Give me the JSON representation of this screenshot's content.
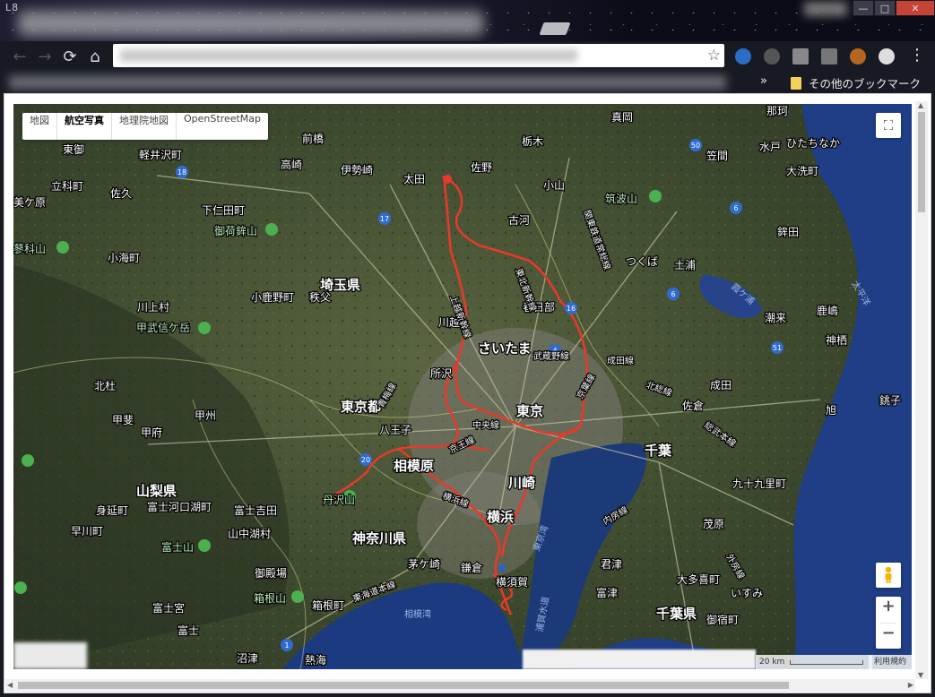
{
  "window": {
    "app_mark": "L8",
    "minimize": "—",
    "maximize": "□",
    "close": "✕"
  },
  "toolbar": {
    "back": "←",
    "forward": "→",
    "reload": "⟳",
    "home": "⌂",
    "star": "☆",
    "menu": "⋮"
  },
  "bookmarks": {
    "more": "»",
    "other": "その他のブックマーク"
  },
  "map": {
    "types": [
      "地図",
      "航空写真",
      "地理院地図",
      "OpenStreetMap"
    ],
    "active_type": "航空写真",
    "fullscreen": "⛶",
    "zoom_in": "+",
    "zoom_out": "−",
    "scale": "20 km",
    "terms": "利用規約",
    "route_color": "#e53a2c",
    "prefectures": {
      "saitama": "埼玉県",
      "tokyo": "東京都",
      "kanagawa": "神奈川県",
      "yamanashi": "山梨県",
      "chiba": "千葉県"
    },
    "cities": {
      "maebashi": "前橋",
      "takasaki": "高崎",
      "isesaki": "伊勢崎",
      "ota": "太田",
      "sano": "佐野",
      "tochigi": "栃木",
      "mooka": "真岡",
      "kasama": "笠間",
      "mito": "水戸",
      "hitachinaka": "ひたちなか",
      "oarai": "大洗町",
      "nakagawa": "那珂",
      "oyama": "小山",
      "koga": "古河",
      "tsukuba": "つくば",
      "tsuchiura": "土浦",
      "hokota": "鉾田",
      "kashima": "鹿嶋",
      "kamisu": "神栖",
      "itako": "潮来",
      "choshi": "銚子",
      "asahi": "旭",
      "narita": "成田",
      "sakura": "佐倉",
      "chiba": "千葉",
      "kujukuri": "九十九里町",
      "mobara": "茂原",
      "otaki": "大多喜町",
      "isumi": "いすみ",
      "onjuku": "御宿町",
      "kisarazu": "君津",
      "futtsu": "富津",
      "kasukabe": "春日部",
      "saitama": "さいたま",
      "kawagoe": "川越",
      "tokorozawa": "所沢",
      "chichibu": "秩父",
      "ogano": "小鹿野町",
      "tokyo": "東京",
      "hachioji": "八王子",
      "sagamihara": "相模原",
      "kawasaki": "川崎",
      "yokohama": "横浜",
      "chigasaki": "茅ケ崎",
      "kamakura": "鎌倉",
      "yokosuka": "横須賀",
      "hakone": "箱根町",
      "atami": "熱海",
      "numazu": "沼津",
      "odawara": "御殿場",
      "yamanakako": "山中湖村",
      "fujiyoshida": "富士吉田",
      "fujikawaguchiko": "富士河口湖町",
      "mishima": "富士宮",
      "fuji": "富士",
      "minobu": "身延町",
      "hayakawa": "早川町",
      "kofu": "甲府",
      "kai": "甲斐",
      "koshu": "甲州",
      "hokuto": "北杜",
      "komagane": "小海町",
      "kawakami": "川上村",
      "saku": "佐久",
      "karuizawa": "軽井沢町",
      "tomi": "東御",
      "tateshina": "立科町",
      "miyota": "美ケ原",
      "shimonita": "下仁田町"
    },
    "mountains": {
      "tsukuba": "筑波山",
      "ontakesan": "御荷鉾山",
      "kobushi": "甲武信ケ岳",
      "tanzawa": "丹沢山",
      "fuji": "富士山",
      "hakone": "箱根山",
      "tateshina": "蓼科山"
    },
    "rail_lines": {
      "joetsu": "上越新幹線",
      "tohoku": "東北新幹線",
      "kanto": "関東鉄道常総線",
      "musashino": "武蔵野線",
      "chuo": "中央線",
      "keio": "京王線",
      "yokohama": "横浜線",
      "tokaido": "東海道本線",
      "keiyo": "京葉線",
      "sobu": "総武本線",
      "hokuso": "北総線",
      "narita": "成田線",
      "uchibo": "内房線",
      "sotobo": "外房線",
      "ome": "青梅線"
    },
    "water": {
      "sagami_bay": "相模湾",
      "tokyo_bay": "東京湾",
      "uraga": "浦賀水道",
      "kasumigaura": "霞ケ浦",
      "ocean": "太平洋"
    },
    "routes": [
      "18",
      "17",
      "4",
      "16",
      "20",
      "50",
      "6",
      "51",
      "1",
      "6"
    ]
  }
}
